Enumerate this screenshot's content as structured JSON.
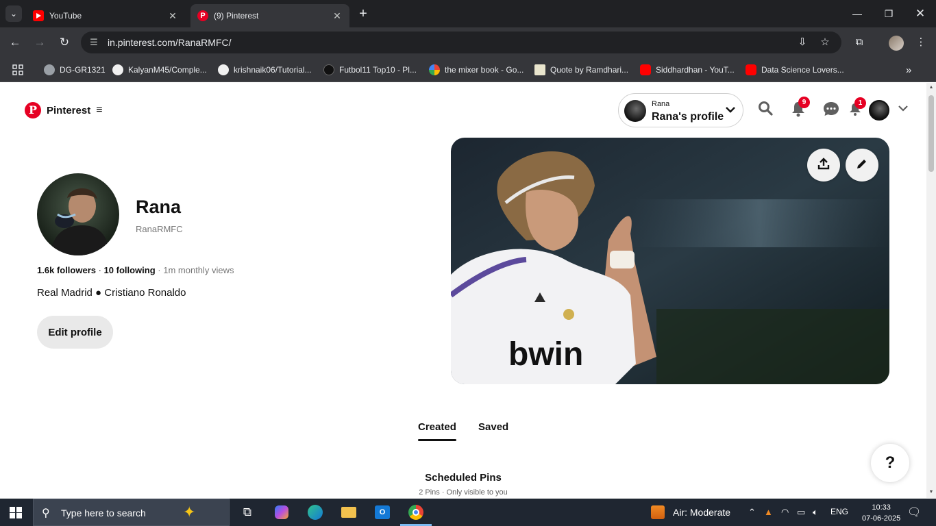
{
  "browser": {
    "tabs": [
      {
        "title": "YouTube",
        "icon": "youtube-icon",
        "active": false
      },
      {
        "title": "(9) Pinterest",
        "icon": "pinterest-icon",
        "active": true
      }
    ],
    "url": "in.pinterest.com/RanaRMFC/",
    "bookmarks": [
      {
        "label": "DG-GR1321",
        "icon": "globe-icon"
      },
      {
        "label": "KalyanM45/Comple...",
        "icon": "github-icon"
      },
      {
        "label": "krishnaik06/Tutorial...",
        "icon": "github-icon"
      },
      {
        "label": "Futbol11 Top10 - Pl...",
        "icon": "futbol11-icon"
      },
      {
        "label": "the mixer book - Go...",
        "icon": "google-icon"
      },
      {
        "label": "Quote by Ramdhari...",
        "icon": "goodreads-icon"
      },
      {
        "label": "Siddhardhan - YouT...",
        "icon": "youtube-icon"
      },
      {
        "label": "Data Science Lovers...",
        "icon": "youtube-icon"
      }
    ],
    "colors": {
      "tabbar": "#202124",
      "toolbar": "#35363a",
      "accent": "#e60023"
    }
  },
  "header": {
    "logo_text": "Pinterest",
    "profile_switch": {
      "small": "Rana",
      "big": "Rana's profile"
    },
    "notifications_badge": "9",
    "updates_badge": "1"
  },
  "profile": {
    "name": "Rana",
    "handle": "RanaRMFC",
    "followers": "1.6k followers",
    "separator": " · ",
    "following": "10 following",
    "monthly_views": "1m monthly views",
    "bio": "Real Madrid ● Cristiano Ronaldo",
    "edit_label": "Edit profile"
  },
  "tabs": {
    "created": "Created",
    "saved": "Saved",
    "active": "Created"
  },
  "scheduled": {
    "title": "Scheduled Pins",
    "subtitle": "2 Pins · Only visible to you"
  },
  "help": {
    "label": "?"
  },
  "taskbar": {
    "search_placeholder": "Type here to search",
    "weather": "Air: Moderate",
    "language": "ENG",
    "time": "10:33",
    "date": "07-06-2025"
  }
}
